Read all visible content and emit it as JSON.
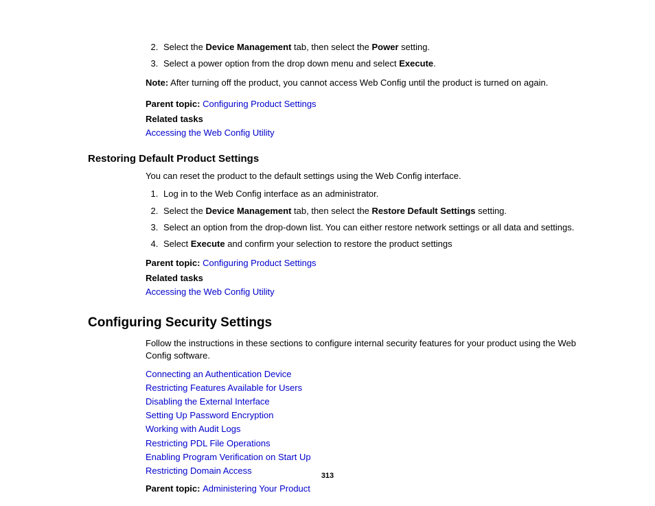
{
  "section1": {
    "step2_pre": "Select the ",
    "step2_b1": "Device Management",
    "step2_mid": " tab, then select the ",
    "step2_b2": "Power",
    "step2_post": " setting.",
    "step3_pre": "Select a power option from the drop down menu and select ",
    "step3_b1": "Execute",
    "step3_post": ".",
    "note_b": "Note:",
    "note_text": " After turning off the product, you cannot access Web Config until the product is turned on again.",
    "parent_label": "Parent topic: ",
    "parent_link": "Configuring Product Settings",
    "related_heading": "Related tasks",
    "related_link": "Accessing the Web Config Utility"
  },
  "section2": {
    "heading": "Restoring Default Product Settings",
    "intro": "You can reset the product to the default settings using the Web Config interface.",
    "step1": "Log in to the Web Config interface as an administrator.",
    "step2_pre": "Select the ",
    "step2_b1": "Device Management",
    "step2_mid": " tab, then select the ",
    "step2_b2": "Restore Default Settings",
    "step2_post": " setting.",
    "step3": "Select an option from the drop-down list. You can either restore network settings or all data and settings.",
    "step4_pre": "Select ",
    "step4_b1": "Execute",
    "step4_post": " and confirm your selection to restore the product settings",
    "parent_label": "Parent topic: ",
    "parent_link": "Configuring Product Settings",
    "related_heading": "Related tasks",
    "related_link": "Accessing the Web Config Utility"
  },
  "section3": {
    "heading": "Configuring Security Settings",
    "intro": "Follow the instructions in these sections to configure internal security features for your product using the Web Config software.",
    "links": [
      "Connecting an Authentication Device",
      "Restricting Features Available for Users",
      "Disabling the External Interface",
      "Setting Up Password Encryption",
      "Working with Audit Logs",
      "Restricting PDL File Operations",
      "Enabling Program Verification on Start Up",
      "Restricting Domain Access"
    ],
    "parent_label": "Parent topic: ",
    "parent_link": "Administering Your Product"
  },
  "pagenum": "313"
}
